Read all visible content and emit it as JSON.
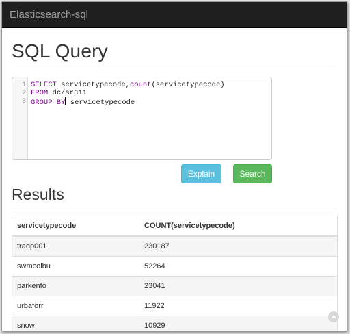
{
  "app": {
    "brand": "Elasticsearch-sql"
  },
  "page": {
    "title": "SQL Query"
  },
  "editor": {
    "line_numbers": [
      "1",
      "2",
      "3"
    ],
    "lines": [
      {
        "parts": [
          {
            "text": "SELECT",
            "type": "keyword"
          },
          {
            "text": " servicetypecode,",
            "type": "plain"
          },
          {
            "text": "count",
            "type": "function"
          },
          {
            "text": "(servicetypecode)",
            "type": "plain"
          }
        ]
      },
      {
        "parts": [
          {
            "text": "FROM",
            "type": "keyword"
          },
          {
            "text": " dc/sr311",
            "type": "plain"
          }
        ]
      },
      {
        "parts": [
          {
            "text": "GROUP BY",
            "type": "keyword"
          },
          {
            "text": " servicetypecode",
            "type": "plain"
          }
        ]
      }
    ]
  },
  "buttons": {
    "explain": "Explain",
    "search": "Search"
  },
  "results": {
    "title": "Results",
    "columns": [
      "servicetypecode",
      "COUNT(servicetypecode)"
    ],
    "rows": [
      [
        "traop001",
        "230187"
      ],
      [
        "swmcolbu",
        "52264"
      ],
      [
        "parkenfo",
        "23041"
      ],
      [
        "urbaforr",
        "11922"
      ],
      [
        "snow",
        "10929"
      ]
    ]
  },
  "colors": {
    "navbar": "#1f1f1f",
    "explain_button": "#5bc0de",
    "search_button": "#5cb85c",
    "keyword": "#770088"
  },
  "icons": {
    "corner": "share-icon"
  }
}
